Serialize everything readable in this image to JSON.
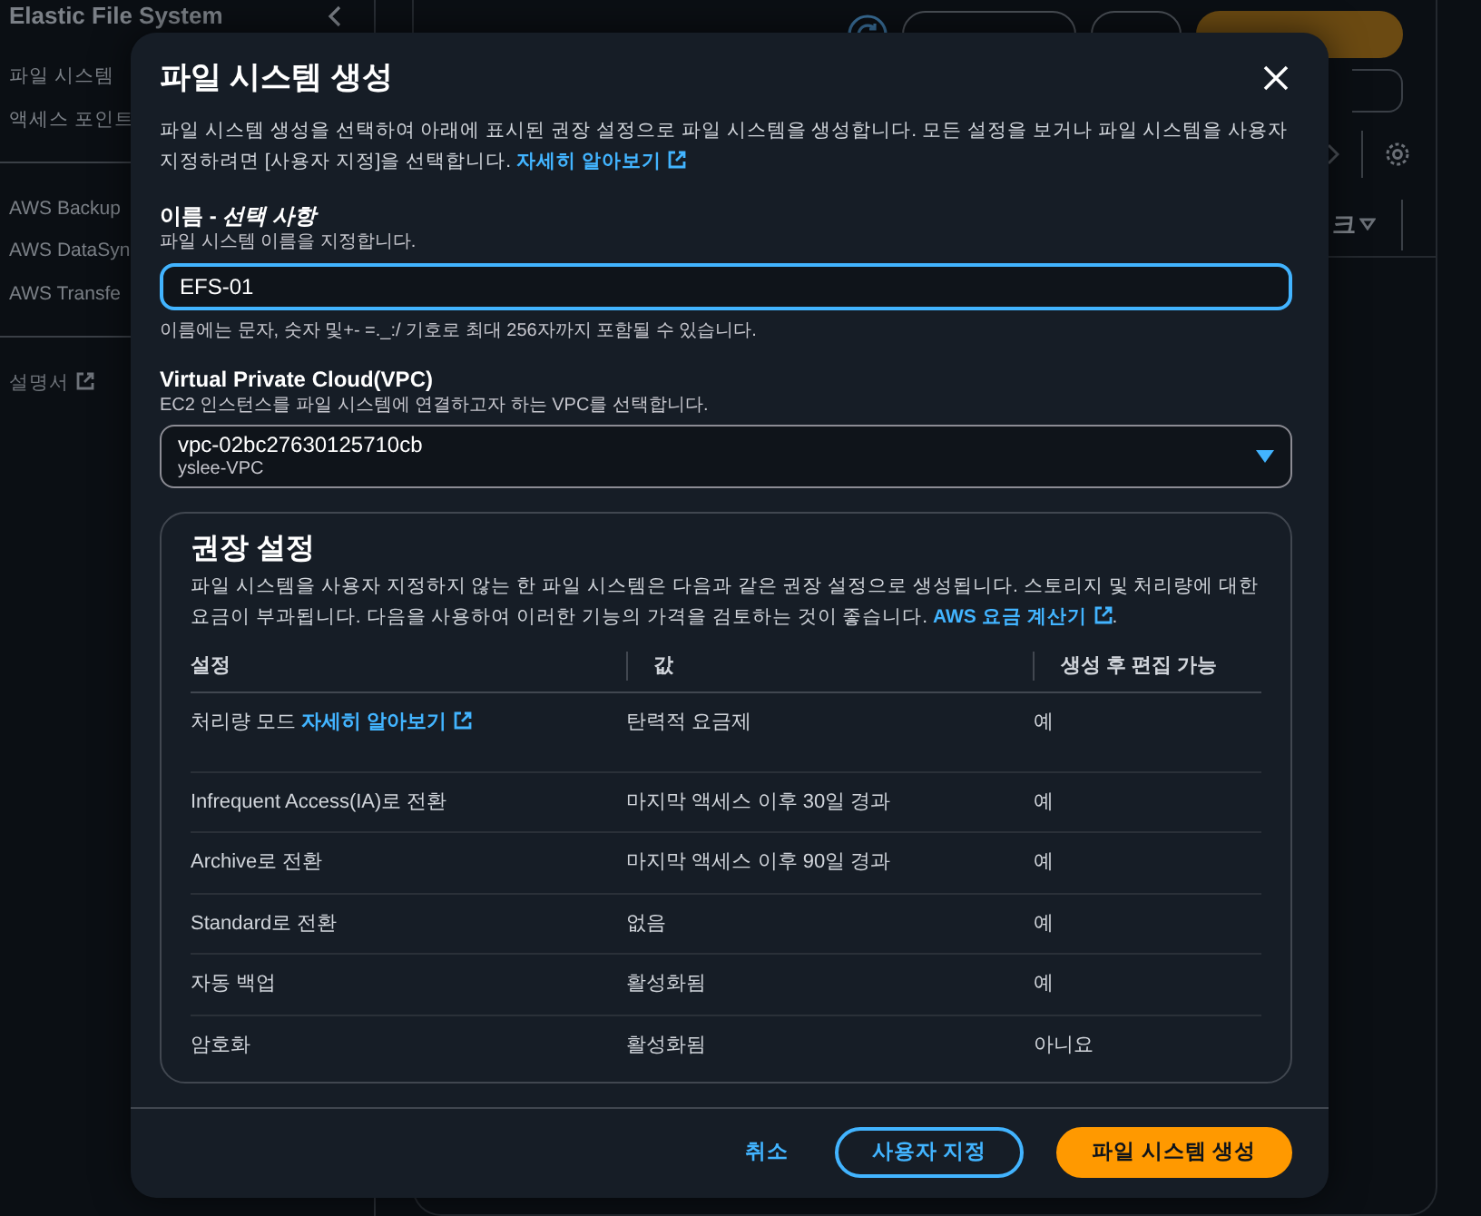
{
  "sidebar": {
    "title": "Elastic File System",
    "items": [
      {
        "label": "파일 시스템"
      },
      {
        "label": "액세스 포인트"
      }
    ],
    "services": [
      {
        "label": "AWS Backup"
      },
      {
        "label": "AWS DataSyn"
      },
      {
        "label": "AWS Transfe"
      }
    ],
    "docs_link": "설명서"
  },
  "main_panel": {
    "buttons": [
      {
        "kind": "normal"
      },
      {
        "kind": "normal"
      },
      {
        "kind": "primary"
      }
    ],
    "column_3": "크"
  },
  "modal": {
    "title": "파일 시스템 생성",
    "description": "파일 시스템 생성을 선택하여 아래에 표시된 권장 설정으로 파일 시스템을 생성합니다. 모든 설정을 보거나 파일 시스템을 사용자 지정하려면 [사용자 지정]을 선택합니다.",
    "description_link": "자세히 알아보기",
    "name_field": {
      "label": "이름 - *선택 사항*",
      "hint": "파일 시스템 이름을 지정합니다.",
      "value": "EFS-01",
      "constraint": "이름에는 문자, 숫자 및+- =._:/ 기호로 최대 256자까지 포함될 수 있습니다."
    },
    "vpc_field": {
      "label": "Virtual Private Cloud(VPC)",
      "hint": "EC2 인스턴스를 파일 시스템에 연결하고자 하는 VPC를 선택합니다.",
      "value": "vpc-02bc27630125710cb",
      "sublabel": "yslee-VPC"
    },
    "recommended": {
      "title": "권장 설정",
      "description": "파일 시스템을 사용자 지정하지 않는 한 파일 시스템은 다음과 같은 권장 설정으로 생성됩니다. 스토리지 및 처리량에 대한 요금이 부과됩니다. 다음을 사용하여 이러한 기능의 가격을 검토하는 것이 좋습니다.",
      "link": "AWS 요금 계산기",
      "link_suffix": ".",
      "columns": [
        "설정",
        "값",
        "생성 후 편집 가능"
      ],
      "rows": [
        {
          "setting": "처리량 모드",
          "setting_link": "자세히 알아보기",
          "value": "탄력적 요금제",
          "editable": "예"
        },
        {
          "setting": "Infrequent Access(IA)로 전환",
          "value": "마지막 액세스 이후 30일 경과",
          "editable": "예"
        },
        {
          "setting": "Archive로 전환",
          "value": "마지막 액세스 이후 90일 경과",
          "editable": "예"
        },
        {
          "setting": "Standard로 전환",
          "value": "없음",
          "editable": "예"
        },
        {
          "setting": "자동 백업",
          "value": "활성화됨",
          "editable": "예"
        },
        {
          "setting": "암호화",
          "value": "활성화됨",
          "editable": "아니요"
        }
      ]
    },
    "buttons": [
      {
        "label": "취소",
        "kind": "link"
      },
      {
        "label": "사용자 지정",
        "kind": "secondary"
      },
      {
        "label": "파일 시스템 생성",
        "kind": "primary"
      }
    ]
  }
}
